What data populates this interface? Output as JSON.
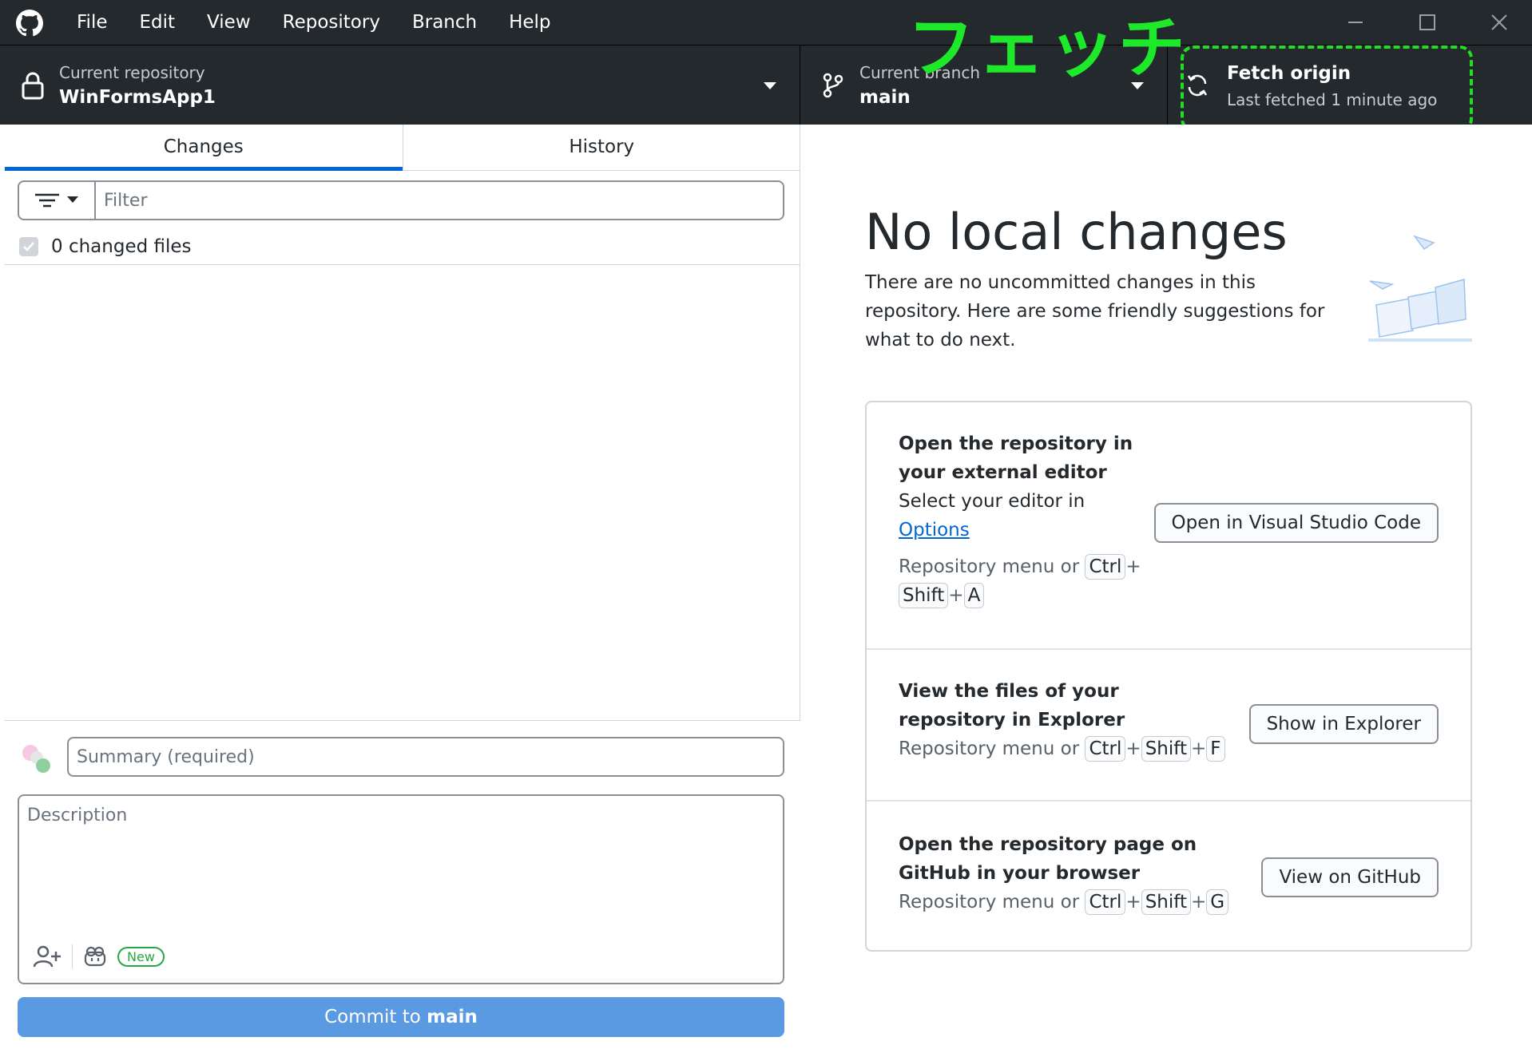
{
  "menu": {
    "items": [
      {
        "label": "File"
      },
      {
        "label": "Edit"
      },
      {
        "label": "View"
      },
      {
        "label": "Repository"
      },
      {
        "label": "Branch"
      },
      {
        "label": "Help"
      }
    ]
  },
  "toolbar": {
    "repo_label": "Current repository",
    "repo_value": "WinFormsApp1",
    "branch_label": "Current branch",
    "branch_value": "main",
    "fetch_label": "Fetch origin",
    "fetch_status": "Last fetched 1 minute ago"
  },
  "annotation": {
    "text": "フェッチ",
    "color": "#1ee82a"
  },
  "tabs": {
    "changes": "Changes",
    "history": "History"
  },
  "filter": {
    "placeholder": "Filter"
  },
  "changes": {
    "count_label": "0 changed files"
  },
  "commit": {
    "summary_placeholder": "Summary (required)",
    "description_placeholder": "Description",
    "new_badge": "New",
    "button_prefix": "Commit to ",
    "button_branch": "main"
  },
  "main": {
    "heading": "No local changes",
    "intro": "There are no uncommitted changes in this repository. Here are some friendly suggestions for what to do next."
  },
  "suggestions": {
    "editor": {
      "title": "Open the repository in your external editor",
      "text": "Select your editor in",
      "link": "Options",
      "hint_prefix": "Repository menu or",
      "keys": [
        "Ctrl",
        "Shift",
        "A"
      ],
      "button": "Open in Visual Studio Code"
    },
    "explorer": {
      "title": "View the files of your repository in Explorer",
      "hint_prefix": "Repository menu or",
      "keys": [
        "Ctrl",
        "Shift",
        "F"
      ],
      "button": "Show in Explorer"
    },
    "github": {
      "title": "Open the repository page on GitHub in your browser",
      "hint_prefix": "Repository menu or",
      "keys": [
        "Ctrl",
        "Shift",
        "G"
      ],
      "button": "View on GitHub"
    }
  },
  "colors": {
    "titlebar": "#24292e",
    "accent": "#0366d6",
    "commit_button": "#5a9ae3",
    "highlight": "#22dd22"
  }
}
